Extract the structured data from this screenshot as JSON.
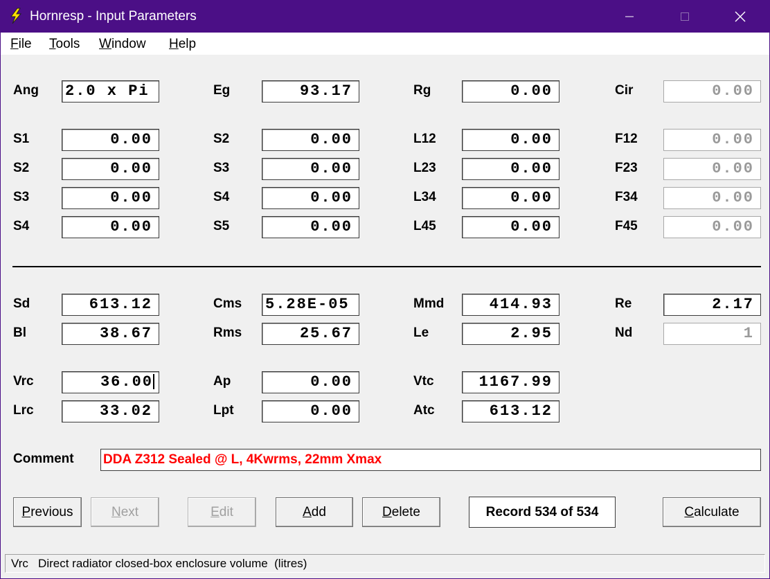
{
  "window": {
    "title": "Hornresp - Input Parameters",
    "colors": {
      "titlebar": "#4b0f86",
      "comment_text": "#ff0000"
    }
  },
  "menu": [
    {
      "mnemonic": "F",
      "rest": "ile"
    },
    {
      "mnemonic": "T",
      "rest": "ools"
    },
    {
      "mnemonic": "W",
      "rest": "indow"
    },
    {
      "mnemonic": "H",
      "rest": "elp"
    }
  ],
  "params": {
    "ang": {
      "label": "Ang",
      "value": "2.0 x Pi"
    },
    "eg": {
      "label": "Eg",
      "value": "93.17"
    },
    "rg": {
      "label": "Rg",
      "value": "0.00"
    },
    "cir": {
      "label": "Cir",
      "value": "0.00"
    },
    "c1r1": {
      "label": "S1",
      "value": "0.00"
    },
    "c1r2": {
      "label": "S2",
      "value": "0.00"
    },
    "c1r3": {
      "label": "S3",
      "value": "0.00"
    },
    "c1r4": {
      "label": "S4",
      "value": "0.00"
    },
    "c2r1": {
      "label": "S2",
      "value": "0.00"
    },
    "c2r2": {
      "label": "S3",
      "value": "0.00"
    },
    "c2r3": {
      "label": "S4",
      "value": "0.00"
    },
    "c2r4": {
      "label": "S5",
      "value": "0.00"
    },
    "c3r1": {
      "label": "L12",
      "value": "0.00"
    },
    "c3r2": {
      "label": "L23",
      "value": "0.00"
    },
    "c3r3": {
      "label": "L34",
      "value": "0.00"
    },
    "c3r4": {
      "label": "L45",
      "value": "0.00"
    },
    "c4r1": {
      "label": "F12",
      "value": "0.00"
    },
    "c4r2": {
      "label": "F23",
      "value": "0.00"
    },
    "c4r3": {
      "label": "F34",
      "value": "0.00"
    },
    "c4r4": {
      "label": "F45",
      "value": "0.00"
    },
    "sd": {
      "label": "Sd",
      "value": "613.12"
    },
    "cms": {
      "label": "Cms",
      "value": "5.28E-05"
    },
    "mmd": {
      "label": "Mmd",
      "value": "414.93"
    },
    "re": {
      "label": "Re",
      "value": "2.17"
    },
    "bl": {
      "label": "Bl",
      "value": "38.67"
    },
    "rms": {
      "label": "Rms",
      "value": "25.67"
    },
    "le": {
      "label": "Le",
      "value": "2.95"
    },
    "nd": {
      "label": "Nd",
      "value": "1"
    },
    "vrc": {
      "label": "Vrc",
      "value": "36.00"
    },
    "ap": {
      "label": "Ap",
      "value": "0.00"
    },
    "vtc": {
      "label": "Vtc",
      "value": "1167.99"
    },
    "lrc": {
      "label": "Lrc",
      "value": "33.02"
    },
    "lpt": {
      "label": "Lpt",
      "value": "0.00"
    },
    "atc": {
      "label": "Atc",
      "value": "613.12"
    }
  },
  "comment": {
    "label": "Comment",
    "value": "DDA Z312 Sealed @ L, 4Kwrms, 22mm Xmax"
  },
  "buttons": {
    "previous": {
      "mnemonic": "P",
      "rest": "revious"
    },
    "next": {
      "mnemonic": "N",
      "rest": "ext"
    },
    "edit": {
      "mnemonic": "E",
      "rest": "dit"
    },
    "add": {
      "mnemonic": "A",
      "rest": "dd"
    },
    "delete": {
      "mnemonic": "D",
      "rest": "elete"
    },
    "calculate": {
      "mnemonic": "C",
      "rest": "alculate"
    }
  },
  "record": "Record 534 of 534",
  "status": "Vrc   Direct radiator closed-box enclosure volume  (litres)"
}
